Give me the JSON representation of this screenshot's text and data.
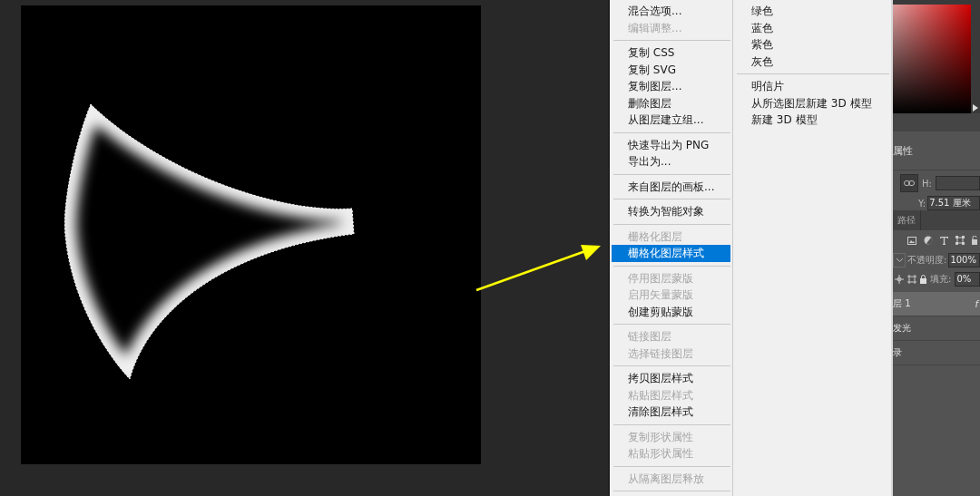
{
  "context_menu": {
    "items": [
      {
        "kind": "item",
        "label": "混合选项...",
        "disabled": false,
        "selected": false
      },
      {
        "kind": "item",
        "label": "编辑调整...",
        "disabled": true,
        "selected": false
      },
      {
        "kind": "separator"
      },
      {
        "kind": "item",
        "label": "复制 CSS",
        "disabled": false,
        "selected": false
      },
      {
        "kind": "item",
        "label": "复制 SVG",
        "disabled": false,
        "selected": false
      },
      {
        "kind": "item",
        "label": "复制图层...",
        "disabled": false,
        "selected": false
      },
      {
        "kind": "item",
        "label": "删除图层",
        "disabled": false,
        "selected": false
      },
      {
        "kind": "item",
        "label": "从图层建立组...",
        "disabled": false,
        "selected": false
      },
      {
        "kind": "separator"
      },
      {
        "kind": "item",
        "label": "快速导出为 PNG",
        "disabled": false,
        "selected": false
      },
      {
        "kind": "item",
        "label": "导出为...",
        "disabled": false,
        "selected": false
      },
      {
        "kind": "separator"
      },
      {
        "kind": "item",
        "label": "来自图层的画板...",
        "disabled": false,
        "selected": false
      },
      {
        "kind": "separator"
      },
      {
        "kind": "item",
        "label": "转换为智能对象",
        "disabled": false,
        "selected": false
      },
      {
        "kind": "separator"
      },
      {
        "kind": "item",
        "label": "栅格化图层",
        "disabled": true,
        "selected": false
      },
      {
        "kind": "item",
        "label": "栅格化图层样式",
        "disabled": false,
        "selected": true
      },
      {
        "kind": "separator"
      },
      {
        "kind": "item",
        "label": "停用图层蒙版",
        "disabled": true,
        "selected": false
      },
      {
        "kind": "item",
        "label": "启用矢量蒙版",
        "disabled": true,
        "selected": false
      },
      {
        "kind": "item",
        "label": "创建剪贴蒙版",
        "disabled": false,
        "selected": false
      },
      {
        "kind": "separator"
      },
      {
        "kind": "item",
        "label": "链接图层",
        "disabled": true,
        "selected": false
      },
      {
        "kind": "item",
        "label": "选择链接图层",
        "disabled": true,
        "selected": false
      },
      {
        "kind": "separator"
      },
      {
        "kind": "item",
        "label": "拷贝图层样式",
        "disabled": false,
        "selected": false
      },
      {
        "kind": "item",
        "label": "粘贴图层样式",
        "disabled": true,
        "selected": false
      },
      {
        "kind": "item",
        "label": "清除图层样式",
        "disabled": false,
        "selected": false
      },
      {
        "kind": "separator"
      },
      {
        "kind": "item",
        "label": "复制形状属性",
        "disabled": true,
        "selected": false
      },
      {
        "kind": "item",
        "label": "粘贴形状属性",
        "disabled": true,
        "selected": false
      },
      {
        "kind": "separator"
      },
      {
        "kind": "item",
        "label": "从隔离图层释放",
        "disabled": true,
        "selected": false
      },
      {
        "kind": "separator"
      }
    ],
    "column_2": [
      {
        "kind": "item",
        "label": "绿色",
        "disabled": false,
        "selected": false
      },
      {
        "kind": "item",
        "label": "蓝色",
        "disabled": false,
        "selected": false
      },
      {
        "kind": "item",
        "label": "紫色",
        "disabled": false,
        "selected": false
      },
      {
        "kind": "item",
        "label": "灰色",
        "disabled": false,
        "selected": false
      },
      {
        "kind": "separator"
      },
      {
        "kind": "item",
        "label": "明信片",
        "disabled": false,
        "selected": false
      },
      {
        "kind": "item",
        "label": "从所选图层新建 3D 模型",
        "disabled": false,
        "selected": false
      },
      {
        "kind": "item",
        "label": "新建 3D 模型",
        "disabled": false,
        "selected": false
      }
    ]
  },
  "properties_panel": {
    "title": "属性",
    "h_label": "H:",
    "y_label": "Y:",
    "y_value": "7.51 厘米"
  },
  "layers_panel": {
    "tab": "路径",
    "opacity_label": "不透明度:",
    "opacity_value": "100%",
    "fill_label": "填充:",
    "fill_value": "0%",
    "layers": [
      {
        "name": "层 1",
        "badge": "f",
        "selected": true
      },
      {
        "name": "发光",
        "selected": false
      },
      {
        "name": "录",
        "selected": false
      }
    ]
  }
}
